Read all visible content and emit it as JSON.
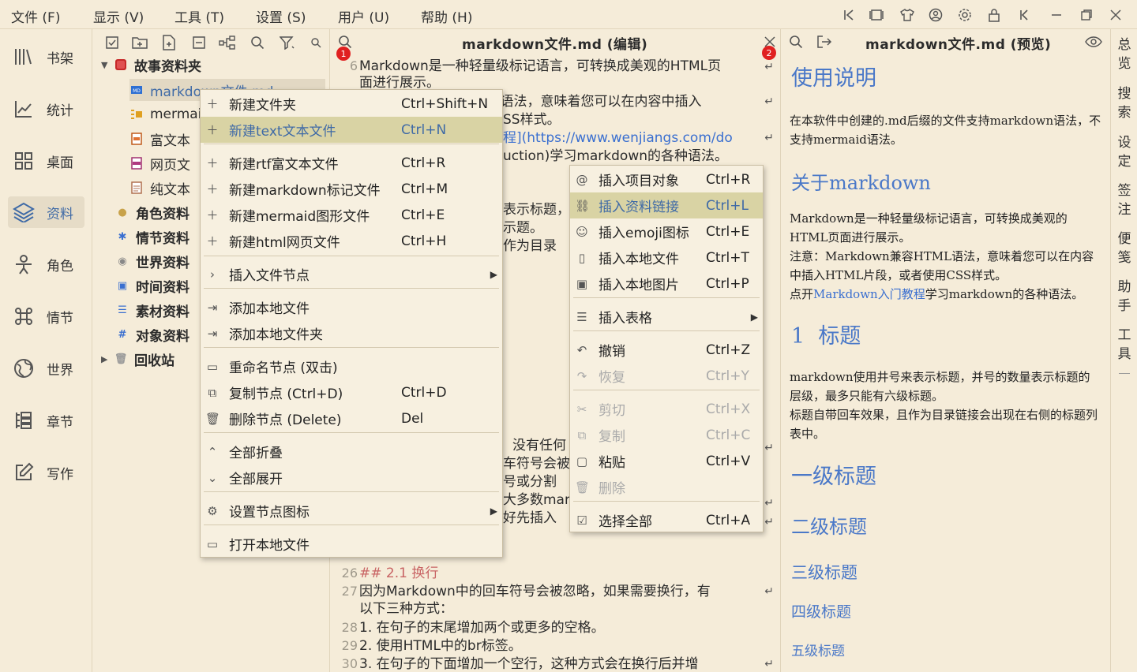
{
  "menubar": {
    "items": [
      "文件 (F)",
      "显示 (V)",
      "工具 (T)",
      "设置 (S)",
      "用户 (U)",
      "帮助 (H)"
    ]
  },
  "leftnav": {
    "items": [
      {
        "label": "书架",
        "icon": "bookshelf-icon"
      },
      {
        "label": "统计",
        "icon": "chart-icon"
      },
      {
        "label": "桌面",
        "icon": "grid-icon"
      },
      {
        "label": "资料",
        "icon": "layers-icon"
      },
      {
        "label": "角色",
        "icon": "person-icon"
      },
      {
        "label": "情节",
        "icon": "command-icon"
      },
      {
        "label": "世界",
        "icon": "globe-icon"
      },
      {
        "label": "章节",
        "icon": "list-icon"
      },
      {
        "label": "写作",
        "icon": "edit-icon"
      }
    ],
    "active": "资料"
  },
  "tree": {
    "root": "故事资料夹",
    "children": [
      "markdown文件.md",
      "mermaid",
      "富文本",
      "网页文",
      "纯文本"
    ],
    "folders": [
      "角色资料",
      "情节资料",
      "世界资料",
      "时间资料",
      "素材资料",
      "对象资料",
      "回收站"
    ]
  },
  "editor": {
    "title": "markdown文件.md (编辑)",
    "lines": [
      {
        "n": "6",
        "t": "Markdown是一种轻量级标记语言，可转换成美观的HTML页"
      },
      {
        "n": "",
        "t": "面进行展示。"
      },
      {
        "n": "",
        "t": "TML语法，意味着您可以在内容中插入"
      },
      {
        "n": "",
        "t": "SS样式。"
      },
      {
        "n": "",
        "t": "程](https://www.wenjiangs.com/do"
      },
      {
        "n": "",
        "t": "uction)学习markdown的各种语法。"
      },
      {
        "n": "",
        "t": "表示标题，"
      },
      {
        "n": "",
        "t": "示题。"
      },
      {
        "n": "",
        "t": "作为目录"
      },
      {
        "n": "",
        "t": "没有任何"
      },
      {
        "n": "",
        "t": "车符号会被"
      },
      {
        "n": "",
        "t": "号或分割"
      },
      {
        "n": "",
        "t": "大多数mark"
      },
      {
        "n": "",
        "t": "好先插入"
      },
      {
        "n": "26",
        "t": "## 2.1 换行"
      },
      {
        "n": "27",
        "t": "因为Markdown中的回车符号会被忽略，如果需要换行，有"
      },
      {
        "n": "",
        "t": "以下三种方式："
      },
      {
        "n": "28",
        "t": "1. 在句子的末尾增加两个或更多的空格。"
      },
      {
        "n": "29",
        "t": "2. 使用HTML中的br标签。"
      },
      {
        "n": "30",
        "t": "3. 在句子的下面增加一个空行，这种方式会在换行后并增"
      }
    ],
    "badges": [
      "1",
      "2"
    ]
  },
  "preview": {
    "title": "markdown文件.md (预览)",
    "h_usage": "使用说明",
    "p_usage": "在本软件中创建的.md后缀的文件支持markdown语法，不支持mermaid语法。",
    "h_about": "关于markdown",
    "p_about1": "Markdown是一种轻量级标记语言，可转换成美观的HTML页面进行展示。",
    "p_about2": "注意：Markdown兼容HTML语法，意味着您可以在内容中插入HTML片段，或者使用CSS样式。",
    "p_about3_pre": "点开",
    "p_about3_link": "Markdown入门教程",
    "p_about3_post": "学习markdown的各种语法。",
    "h1_num": "1",
    "h1_text": "标题",
    "p_title1": "markdown使用井号来表示标题，并号的数量表示标题的层级，最多只能有六级标题。",
    "p_title2": "标题自带回车效果，且作为目录链接会出现在右侧的标题列表中。",
    "headings": [
      "一级标题",
      "二级标题",
      "三级标题",
      "四级标题",
      "五级标题"
    ]
  },
  "rightrail": {
    "items": [
      "总览",
      "搜索",
      "设定",
      "签注",
      "便笺",
      "助手",
      "工具"
    ]
  },
  "context_main": {
    "items": [
      {
        "label": "新建文件夹",
        "short": "Ctrl+Shift+N",
        "icon": "plus-icon"
      },
      {
        "label": "新建text文本文件",
        "short": "Ctrl+N",
        "icon": "plus-icon",
        "highlight": true
      },
      {
        "label": "新建rtf富文本文件",
        "short": "Ctrl+R",
        "icon": "plus-icon"
      },
      {
        "label": "新建markdown标记文件",
        "short": "Ctrl+M",
        "icon": "plus-icon"
      },
      {
        "label": "新建mermaid图形文件",
        "short": "Ctrl+E",
        "icon": "plus-icon"
      },
      {
        "label": "新建html网页文件",
        "short": "Ctrl+H",
        "icon": "plus-icon"
      },
      {
        "label": "插入文件节点",
        "short": "",
        "icon": "chevron-right-icon",
        "submenu": true
      },
      {
        "label": "添加本地文件",
        "short": "",
        "icon": "import-icon"
      },
      {
        "label": "添加本地文件夹",
        "short": "",
        "icon": "import-icon"
      },
      {
        "label": "重命名节点 (双击)",
        "short": "",
        "icon": "rename-icon"
      },
      {
        "label": "复制节点 (Ctrl+D)",
        "short": "Ctrl+D",
        "icon": "copy-icon"
      },
      {
        "label": "删除节点 (Delete)",
        "short": "Del",
        "icon": "trash-icon"
      },
      {
        "label": "全部折叠",
        "short": "",
        "icon": "collapse-icon"
      },
      {
        "label": "全部展开",
        "short": "",
        "icon": "expand-icon"
      },
      {
        "label": "设置节点图标",
        "short": "",
        "icon": "settings-icon",
        "submenu": true
      },
      {
        "label": "打开本地文件",
        "short": "",
        "icon": "folder-open-icon"
      }
    ]
  },
  "context_editor": {
    "items": [
      {
        "label": "插入项目对象",
        "short": "Ctrl+R",
        "icon": "at-icon"
      },
      {
        "label": "插入资料链接",
        "short": "Ctrl+L",
        "icon": "link-icon",
        "highlight": true
      },
      {
        "label": "插入emoji图标",
        "short": "Ctrl+E",
        "icon": "emoji-icon"
      },
      {
        "label": "插入本地文件",
        "short": "Ctrl+T",
        "icon": "file-icon"
      },
      {
        "label": "插入本地图片",
        "short": "Ctrl+P",
        "icon": "image-icon"
      },
      {
        "label": "插入表格",
        "short": "",
        "icon": "table-icon",
        "submenu": true
      },
      {
        "label": "撤销",
        "short": "Ctrl+Z",
        "icon": "undo-icon"
      },
      {
        "label": "恢复",
        "short": "Ctrl+Y",
        "icon": "redo-icon",
        "disabled": true
      },
      {
        "label": "剪切",
        "short": "Ctrl+X",
        "icon": "cut-icon",
        "disabled": true
      },
      {
        "label": "复制",
        "short": "Ctrl+C",
        "icon": "copy-icon",
        "disabled": true
      },
      {
        "label": "粘贴",
        "short": "Ctrl+V",
        "icon": "paste-icon"
      },
      {
        "label": "删除",
        "short": "",
        "icon": "trash-icon",
        "disabled": true
      },
      {
        "label": "选择全部",
        "short": "Ctrl+A",
        "icon": "checkbox-icon"
      }
    ]
  }
}
